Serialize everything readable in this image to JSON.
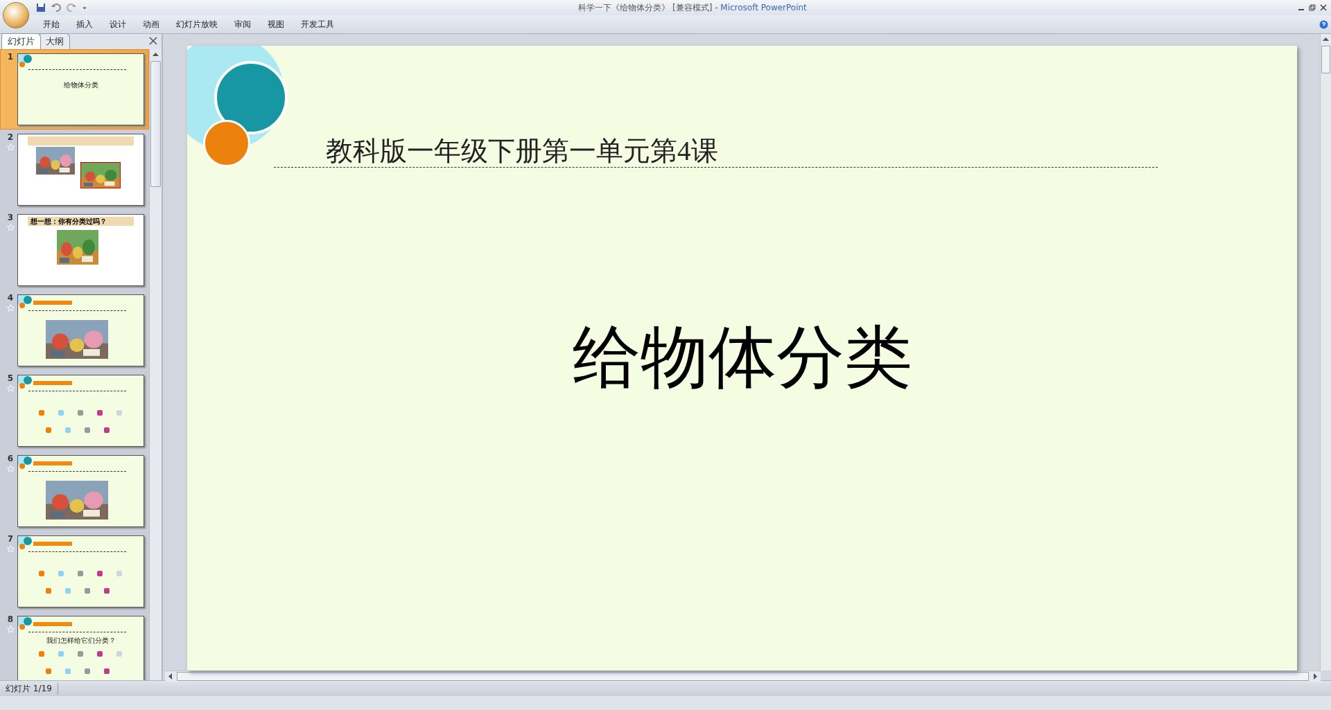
{
  "window": {
    "title": "科学一下《给物体分类》 [兼容模式] - ",
    "app_name": "Microsoft PowerPoint"
  },
  "ribbon_tabs": [
    {
      "label": "开始"
    },
    {
      "label": "插入"
    },
    {
      "label": "设计"
    },
    {
      "label": "动画"
    },
    {
      "label": "幻灯片放映"
    },
    {
      "label": "审阅"
    },
    {
      "label": "视图"
    },
    {
      "label": "开发工具"
    }
  ],
  "panel_tabs": [
    {
      "label": "幻灯片",
      "selected": true
    },
    {
      "label": "大纲",
      "selected": false
    }
  ],
  "slides": [
    {
      "number": "1",
      "selected": true,
      "animated": false,
      "kind": "title",
      "caption": "给物体分类"
    },
    {
      "number": "2",
      "selected": false,
      "animated": true,
      "kind": "banner"
    },
    {
      "number": "3",
      "selected": false,
      "animated": true,
      "kind": "banner",
      "caption": "想一想：你有分类过吗？"
    },
    {
      "number": "4",
      "selected": false,
      "animated": true,
      "kind": "lesson_photo"
    },
    {
      "number": "5",
      "selected": false,
      "animated": true,
      "kind": "lesson_items"
    },
    {
      "number": "6",
      "selected": false,
      "animated": true,
      "kind": "lesson_photo"
    },
    {
      "number": "7",
      "selected": false,
      "animated": true,
      "kind": "lesson_items"
    },
    {
      "number": "8",
      "selected": false,
      "animated": true,
      "kind": "lesson_items",
      "caption": "我们怎样给它们分类？"
    }
  ],
  "slide": {
    "subtitle": "教科版一年级下册第一单元第4课",
    "title": "给物体分类"
  },
  "status_bar": {
    "slide_info": "幻灯片 1/19"
  }
}
